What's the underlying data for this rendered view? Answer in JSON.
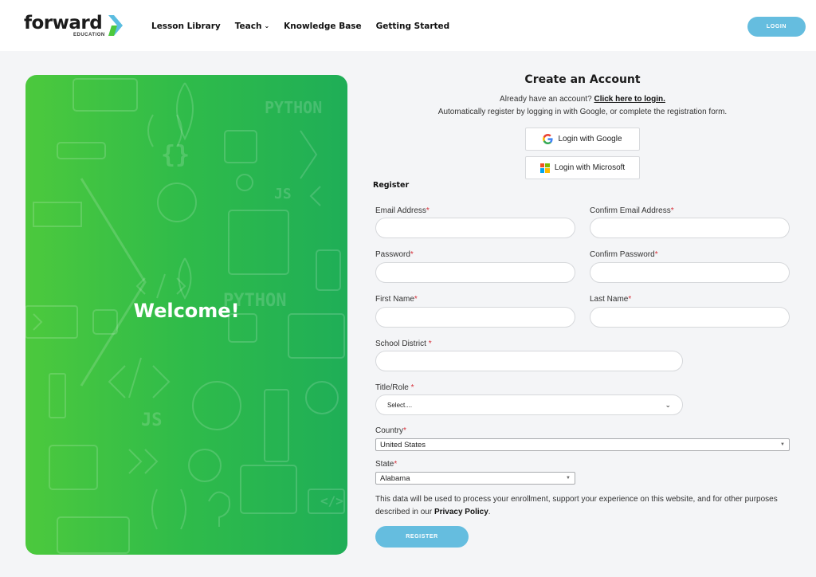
{
  "header": {
    "logo_word": "forward",
    "logo_sub": "EDUCATION",
    "nav": [
      {
        "label": "Lesson Library"
      },
      {
        "label": "Teach"
      },
      {
        "label": "Knowledge Base"
      },
      {
        "label": "Getting Started"
      }
    ],
    "login_label": "LOGIN"
  },
  "welcome": {
    "text": "Welcome!",
    "pattern_words": [
      "PYTHON",
      "JS",
      "PYTHON",
      "JS",
      "</>",
      "{}"
    ]
  },
  "form": {
    "title": "Create an Account",
    "have_account": "Already have an account?",
    "login_link": "Click here to login.",
    "auto_register": "Automatically register by logging in with Google, or complete the registration form.",
    "google_label": "Login with Google",
    "microsoft_label": "Login with Microsoft",
    "register_heading": "Register",
    "fields": {
      "email": {
        "label": "Email Address",
        "required": "*",
        "value": ""
      },
      "confirm_email": {
        "label": "Confirm Email Address",
        "required": "*",
        "value": ""
      },
      "password": {
        "label": "Password",
        "required": "*",
        "value": ""
      },
      "confirm_password": {
        "label": "Confirm Password",
        "required": "*",
        "value": ""
      },
      "first_name": {
        "label": "First Name",
        "required": "*",
        "value": ""
      },
      "last_name": {
        "label": "Last Name",
        "required": "*",
        "value": ""
      },
      "school_district": {
        "label": "School District ",
        "required": "*",
        "value": ""
      },
      "title_role": {
        "label": "Title/Role ",
        "required": "*",
        "selected": "Select...."
      },
      "country": {
        "label": "Country",
        "required": "*",
        "selected": "United States"
      },
      "state": {
        "label": "State",
        "required": "*",
        "selected": "Alabama"
      }
    },
    "privacy_text": "This data will be used to process your enrollment, support your experience on this website, and for other purposes described in our ",
    "privacy_link": "Privacy Policy",
    "privacy_end": ".",
    "register_label": "REGISTER"
  },
  "colors": {
    "accent_button": "#65bddf",
    "green_start": "#4cc93d",
    "green_end": "#1fae57",
    "required": "#d6303a"
  }
}
